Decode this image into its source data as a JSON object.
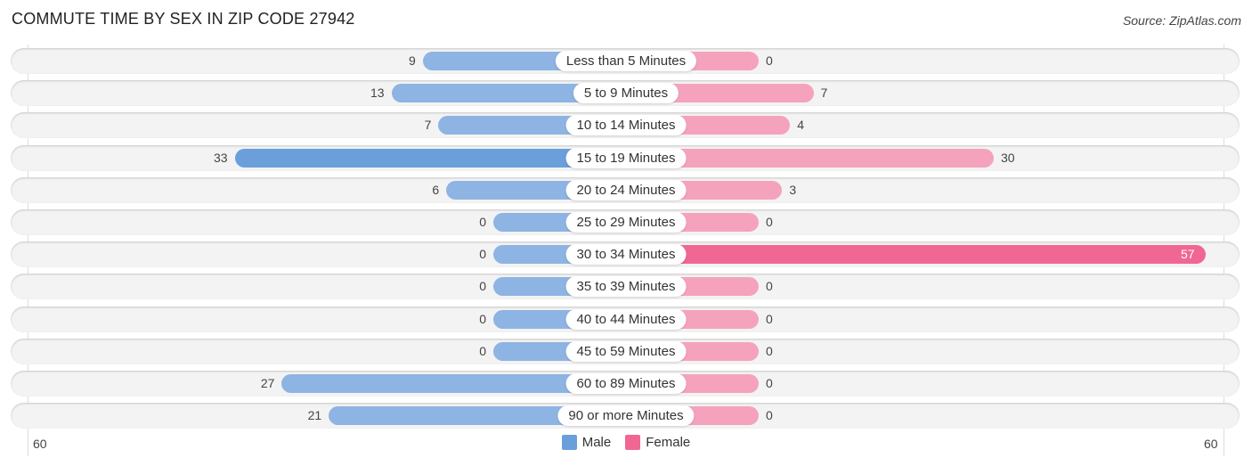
{
  "header": {
    "title": "COMMUTE TIME BY SEX IN ZIP CODE 27942",
    "source": "Source: ZipAtlas.com"
  },
  "colors": {
    "male": "#8db4e2",
    "male_strong": "#6a9fdb",
    "female": "#f5a3bd",
    "female_strong": "#f06794"
  },
  "chart_data": {
    "type": "bar",
    "orientation": "horizontal-diverging",
    "title": "COMMUTE TIME BY SEX IN ZIP CODE 27942",
    "categories": [
      "Less than 5 Minutes",
      "5 to 9 Minutes",
      "10 to 14 Minutes",
      "15 to 19 Minutes",
      "20 to 24 Minutes",
      "25 to 29 Minutes",
      "30 to 34 Minutes",
      "35 to 39 Minutes",
      "40 to 44 Minutes",
      "45 to 59 Minutes",
      "60 to 89 Minutes",
      "90 or more Minutes"
    ],
    "series": [
      {
        "name": "Male",
        "values": [
          9,
          13,
          7,
          33,
          6,
          0,
          0,
          0,
          0,
          0,
          27,
          21
        ]
      },
      {
        "name": "Female",
        "values": [
          0,
          7,
          4,
          30,
          3,
          0,
          57,
          0,
          0,
          0,
          0,
          0
        ]
      }
    ],
    "axis": {
      "left_label": "60",
      "right_label": "60",
      "range": [
        0,
        60
      ]
    },
    "legend": {
      "position": "bottom-center",
      "entries": [
        "Male",
        "Female"
      ]
    }
  }
}
